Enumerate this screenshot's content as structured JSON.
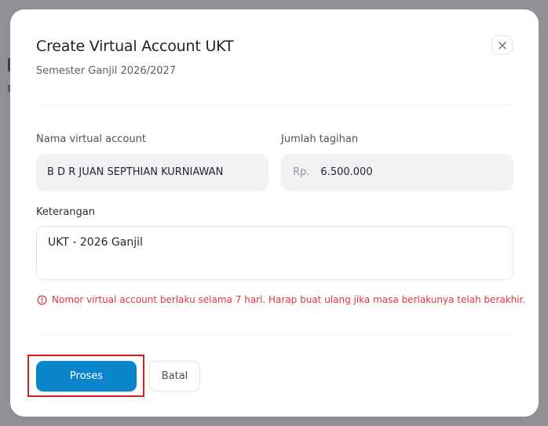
{
  "modal": {
    "title": "Create Virtual Account UKT",
    "subtitle": "Semester Ganjil 2026/2027"
  },
  "form": {
    "name_label": "Nama virtual account",
    "name_value": "B D R JUAN SEPTHIAN KURNIAWAN",
    "amount_label": "Jumlah tagihan",
    "amount_prefix": "Rp.",
    "amount_value": "6.500.000",
    "notes_label": "Keterangan",
    "notes_value": "UKT - 2026 Ganjil"
  },
  "warning": {
    "text": "Nomor virtual account berlaku selama 7 hari. Harap buat ulang jika masa berlakunya telah berakhir.",
    "color": "#e3343b"
  },
  "actions": {
    "primary_label": "Proses",
    "secondary_label": "Batal"
  },
  "colors": {
    "primary": "#0a85cc",
    "highlight": "#d61d1d",
    "overlay": "#8e9094"
  },
  "icons": {
    "close": "close-icon",
    "warning": "alert-circle-icon"
  }
}
